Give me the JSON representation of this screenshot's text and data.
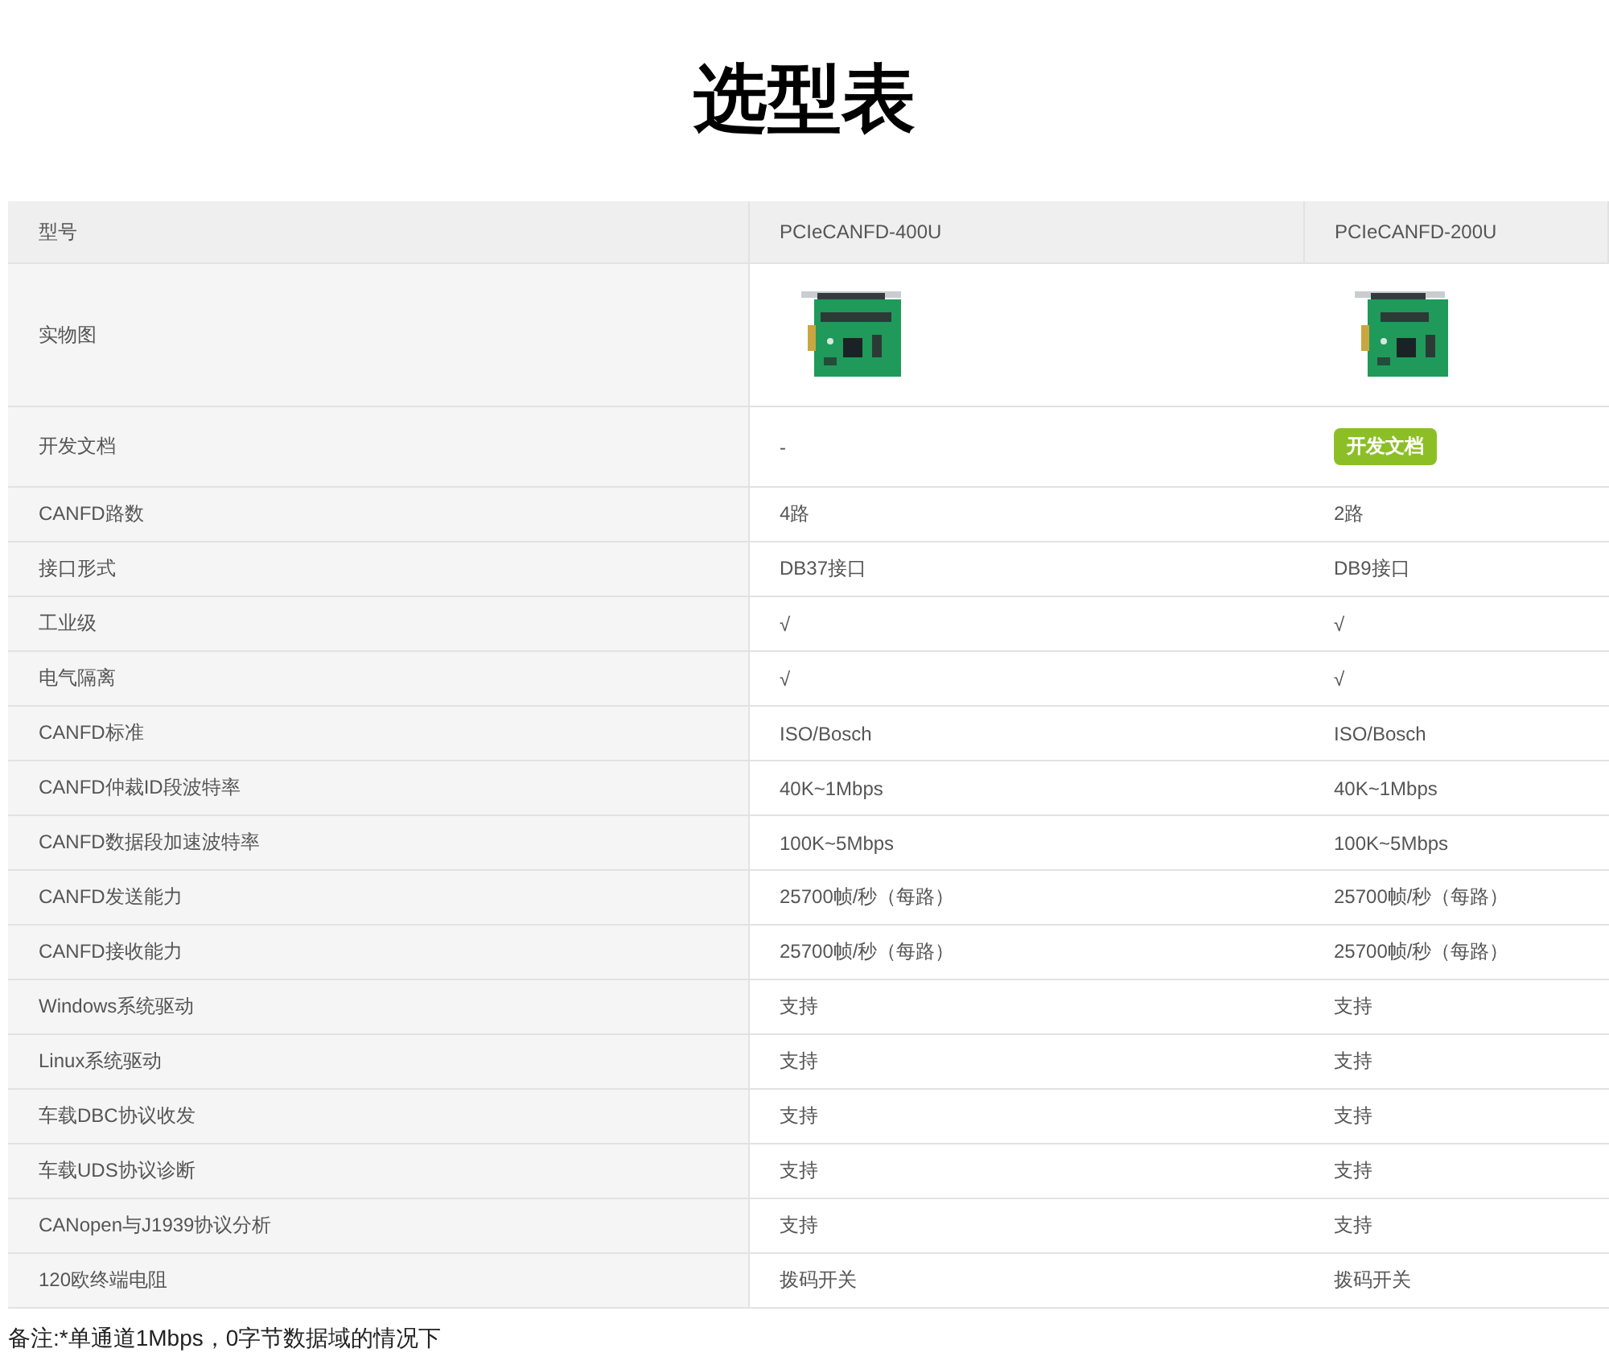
{
  "title": "选型表",
  "table": {
    "header": {
      "label": "型号",
      "cells": [
        "PCIeCANFD-400U",
        "PCIeCANFD-200U"
      ]
    },
    "rows": [
      {
        "label": "实物图"
      },
      {
        "label": "开发文档",
        "kind": "doc",
        "cells": [
          {
            "kind": "text",
            "text": "-"
          },
          {
            "kind": "link",
            "text": "开发文档"
          }
        ]
      },
      {
        "label": "CANFD路数",
        "cells": [
          {
            "kind": "text",
            "text": "4路"
          },
          {
            "kind": "text",
            "text": "2路"
          }
        ]
      },
      {
        "label": "接口形式",
        "cells": [
          {
            "kind": "text",
            "text": "DB37接口"
          },
          {
            "kind": "text",
            "text": "DB9接口"
          }
        ]
      },
      {
        "label": "工业级",
        "cells": [
          {
            "kind": "text",
            "text": "√"
          },
          {
            "kind": "text",
            "text": "√"
          }
        ]
      },
      {
        "label": "电气隔离",
        "cells": [
          {
            "kind": "text",
            "text": "√"
          },
          {
            "kind": "text",
            "text": "√"
          }
        ]
      },
      {
        "label": "CANFD标准",
        "cells": [
          {
            "kind": "text",
            "text": "ISO/Bosch"
          },
          {
            "kind": "text",
            "text": "ISO/Bosch"
          }
        ]
      },
      {
        "label": "CANFD仲裁ID段波特率",
        "cells": [
          {
            "kind": "text",
            "text": "40K~1Mbps"
          },
          {
            "kind": "text",
            "text": "40K~1Mbps"
          }
        ]
      },
      {
        "label": "CANFD数据段加速波特率",
        "cells": [
          {
            "kind": "text",
            "text": "100K~5Mbps"
          },
          {
            "kind": "text",
            "text": "100K~5Mbps"
          }
        ]
      },
      {
        "label": "CANFD发送能力",
        "cells": [
          {
            "kind": "text",
            "text": "25700帧/秒（每路）"
          },
          {
            "kind": "text",
            "text": "25700帧/秒（每路）"
          }
        ]
      },
      {
        "label": "CANFD接收能力",
        "cells": [
          {
            "kind": "text",
            "text": "25700帧/秒（每路）"
          },
          {
            "kind": "text",
            "text": "25700帧/秒（每路）"
          }
        ]
      },
      {
        "label": "Windows系统驱动",
        "cells": [
          {
            "kind": "text",
            "text": "支持"
          },
          {
            "kind": "text",
            "text": "支持"
          }
        ]
      },
      {
        "label": "Linux系统驱动",
        "cells": [
          {
            "kind": "text",
            "text": "支持"
          },
          {
            "kind": "text",
            "text": "支持"
          }
        ]
      },
      {
        "label": "车载DBC协议收发",
        "cells": [
          {
            "kind": "text",
            "text": "支持"
          },
          {
            "kind": "text",
            "text": "支持"
          }
        ]
      },
      {
        "label": "车载UDS协议诊断",
        "cells": [
          {
            "kind": "text",
            "text": "支持"
          },
          {
            "kind": "text",
            "text": "支持"
          }
        ]
      },
      {
        "label": "CANopen与J1939协议分析",
        "cells": [
          {
            "kind": "text",
            "text": "支持"
          },
          {
            "kind": "text",
            "text": "支持"
          }
        ]
      },
      {
        "label": "120欧终端电阻",
        "cells": [
          {
            "kind": "text",
            "text": "拨码开关"
          },
          {
            "kind": "text",
            "text": "拨码开关"
          }
        ]
      }
    ]
  },
  "note": "备注:*单通道1Mbps，0字节数据域的情况下"
}
